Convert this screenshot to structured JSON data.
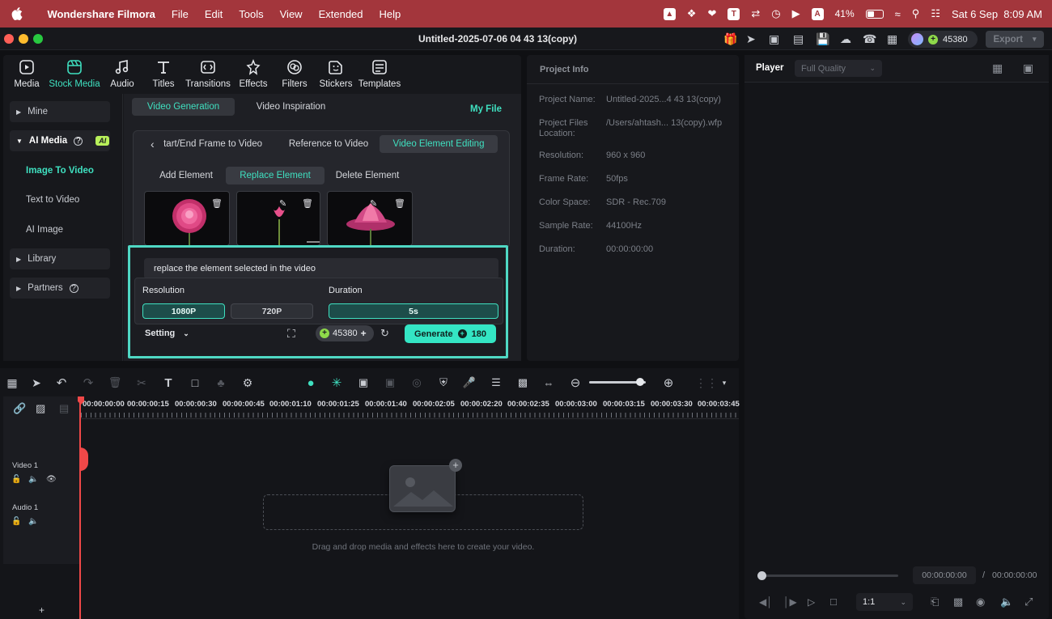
{
  "menubar": {
    "app_name": "Wondershare Filmora",
    "items": [
      "File",
      "Edit",
      "Tools",
      "View",
      "Extended",
      "Help"
    ],
    "battery": "41%",
    "datetime": "Sat 6 Sep  8:09 AM"
  },
  "titlebar": {
    "title": "Untitled-2025-07-06 04 43 13(copy)",
    "credits": "45380",
    "export_label": "Export"
  },
  "media_tabs": [
    {
      "label": "Media"
    },
    {
      "label": "Stock Media"
    },
    {
      "label": "Audio"
    },
    {
      "label": "Titles"
    },
    {
      "label": "Transitions"
    },
    {
      "label": "Effects"
    },
    {
      "label": "Filters"
    },
    {
      "label": "Stickers"
    },
    {
      "label": "Templates"
    }
  ],
  "sidebar": {
    "mine": "Mine",
    "ai_media": "AI Media",
    "ai_badge": "AI",
    "image_to_video": "Image To Video",
    "text_to_video": "Text to Video",
    "ai_image": "AI Image",
    "library": "Library",
    "partners": "Partners"
  },
  "gen": {
    "tab_generation": "Video Generation",
    "tab_inspiration": "Video Inspiration",
    "my_file": "My File",
    "sub_start_end": "Start/End Frame to Video",
    "sub_reference": "Reference to Video",
    "sub_element_editing": "Video Element Editing",
    "add_element": "Add Element",
    "replace_element": "Replace Element",
    "delete_element": "Delete Element",
    "prompt_text": "replace the element selected in the video",
    "resolution_label": "Resolution",
    "duration_label": "Duration",
    "res_1080": "1080P",
    "res_720": "720P",
    "dur_5s": "5s",
    "setting": "Setting",
    "credits": "45380",
    "generate": "Generate",
    "generate_cost": "180"
  },
  "project_info": {
    "header": "Project Info",
    "rows": [
      {
        "label": "Project Name:",
        "value": "Untitled-2025...4 43 13(copy)"
      },
      {
        "label": "Project Files Location:",
        "value": "/Users/ahtash... 13(copy).wfp"
      },
      {
        "label": "Resolution:",
        "value": "960 x 960"
      },
      {
        "label": "Frame Rate:",
        "value": "50fps"
      },
      {
        "label": "Color Space:",
        "value": "SDR - Rec.709"
      },
      {
        "label": "Sample Rate:",
        "value": "44100Hz"
      },
      {
        "label": "Duration:",
        "value": "00:00:00:00"
      }
    ]
  },
  "player": {
    "label": "Player",
    "quality": "Full Quality",
    "time_current": "00:00:00:00",
    "time_sep": "/",
    "time_total": "00:00:00:00",
    "ratio": "1:1"
  },
  "timeline": {
    "ticks": [
      "00:00:00:00",
      "00:00:00:15",
      "00:00:00:30",
      "00:00:00:45",
      "00:00:01:10",
      "00:00:01:25",
      "00:00:01:40",
      "00:00:02:05",
      "00:00:02:20",
      "00:00:02:35",
      "00:00:03:00",
      "00:00:03:15",
      "00:00:03:30",
      "00:00:03:45"
    ],
    "video_track": "Video 1",
    "audio_track": "Audio 1",
    "drop_hint": "Drag and drop media and effects here to create your video.",
    "add_track": "+"
  },
  "colors": {
    "accent": "#3fe0c0",
    "highlight_border": "#4fd8c4",
    "menubar": "#a3363c"
  }
}
